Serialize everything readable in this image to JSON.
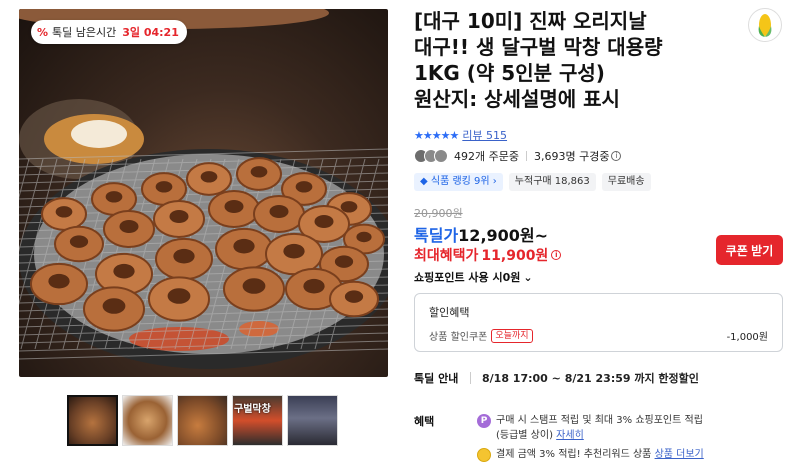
{
  "timer": {
    "icon": "percent-tag-icon",
    "label": "톡딜 남은시간",
    "time": "3일 04:21"
  },
  "thumbnails": [
    {
      "name": "thumb-grill",
      "tag": ""
    },
    {
      "name": "thumb-plate",
      "tag": ""
    },
    {
      "name": "thumb-chopsticks",
      "tag": ""
    },
    {
      "name": "thumb-market-sign",
      "tag": "구벌막창"
    },
    {
      "name": "thumb-street",
      "tag": ""
    }
  ],
  "product": {
    "title_lines": [
      "[대구 10미] 진짜 오리지날",
      "대구!! 생 달구벌 막창 대용량",
      "1KG (약 5인분 구성)",
      "원산지: 상세설명에 표시"
    ],
    "stars": "★★★★★",
    "review_label": "리뷰 515",
    "orders": "492개 주문중",
    "wishers": "3,693명 구경중",
    "chips": {
      "rank": "식품 랭킹 9위",
      "cumulative": "누적구매 18,863",
      "shipping": "무료배송"
    }
  },
  "price": {
    "original": "20,900원",
    "deal_label": "톡딜가",
    "deal_price": "12,900원~",
    "max_label": "최대혜택가",
    "max_price": "11,900원",
    "coupon_button": "쿠폰 받기",
    "points": "쇼핑포인트 사용 시0원"
  },
  "discount_box": {
    "heading": "할인혜택",
    "item": "상품 할인쿠폰",
    "today_badge": "오늘까지",
    "amount": "-1,000원"
  },
  "deal_info": {
    "label": "톡딜 안내",
    "period": "8/18 17:00 ~ 8/21 23:59 까지 한정할인"
  },
  "benefits": {
    "label": "혜택",
    "line1": "구매 시 스탬프 적립 및 최대 3% 쇼핑포인트 적립",
    "line1b": "(등급별 상이)",
    "line1_link": "자세히",
    "line2": "결제 금액 3% 적립! 추천리워드 상품",
    "line2_link": "상품 더보기"
  },
  "colors": {
    "accent_red": "#e5262c",
    "accent_blue": "#1e64e6",
    "link_blue": "#3a62c9"
  }
}
